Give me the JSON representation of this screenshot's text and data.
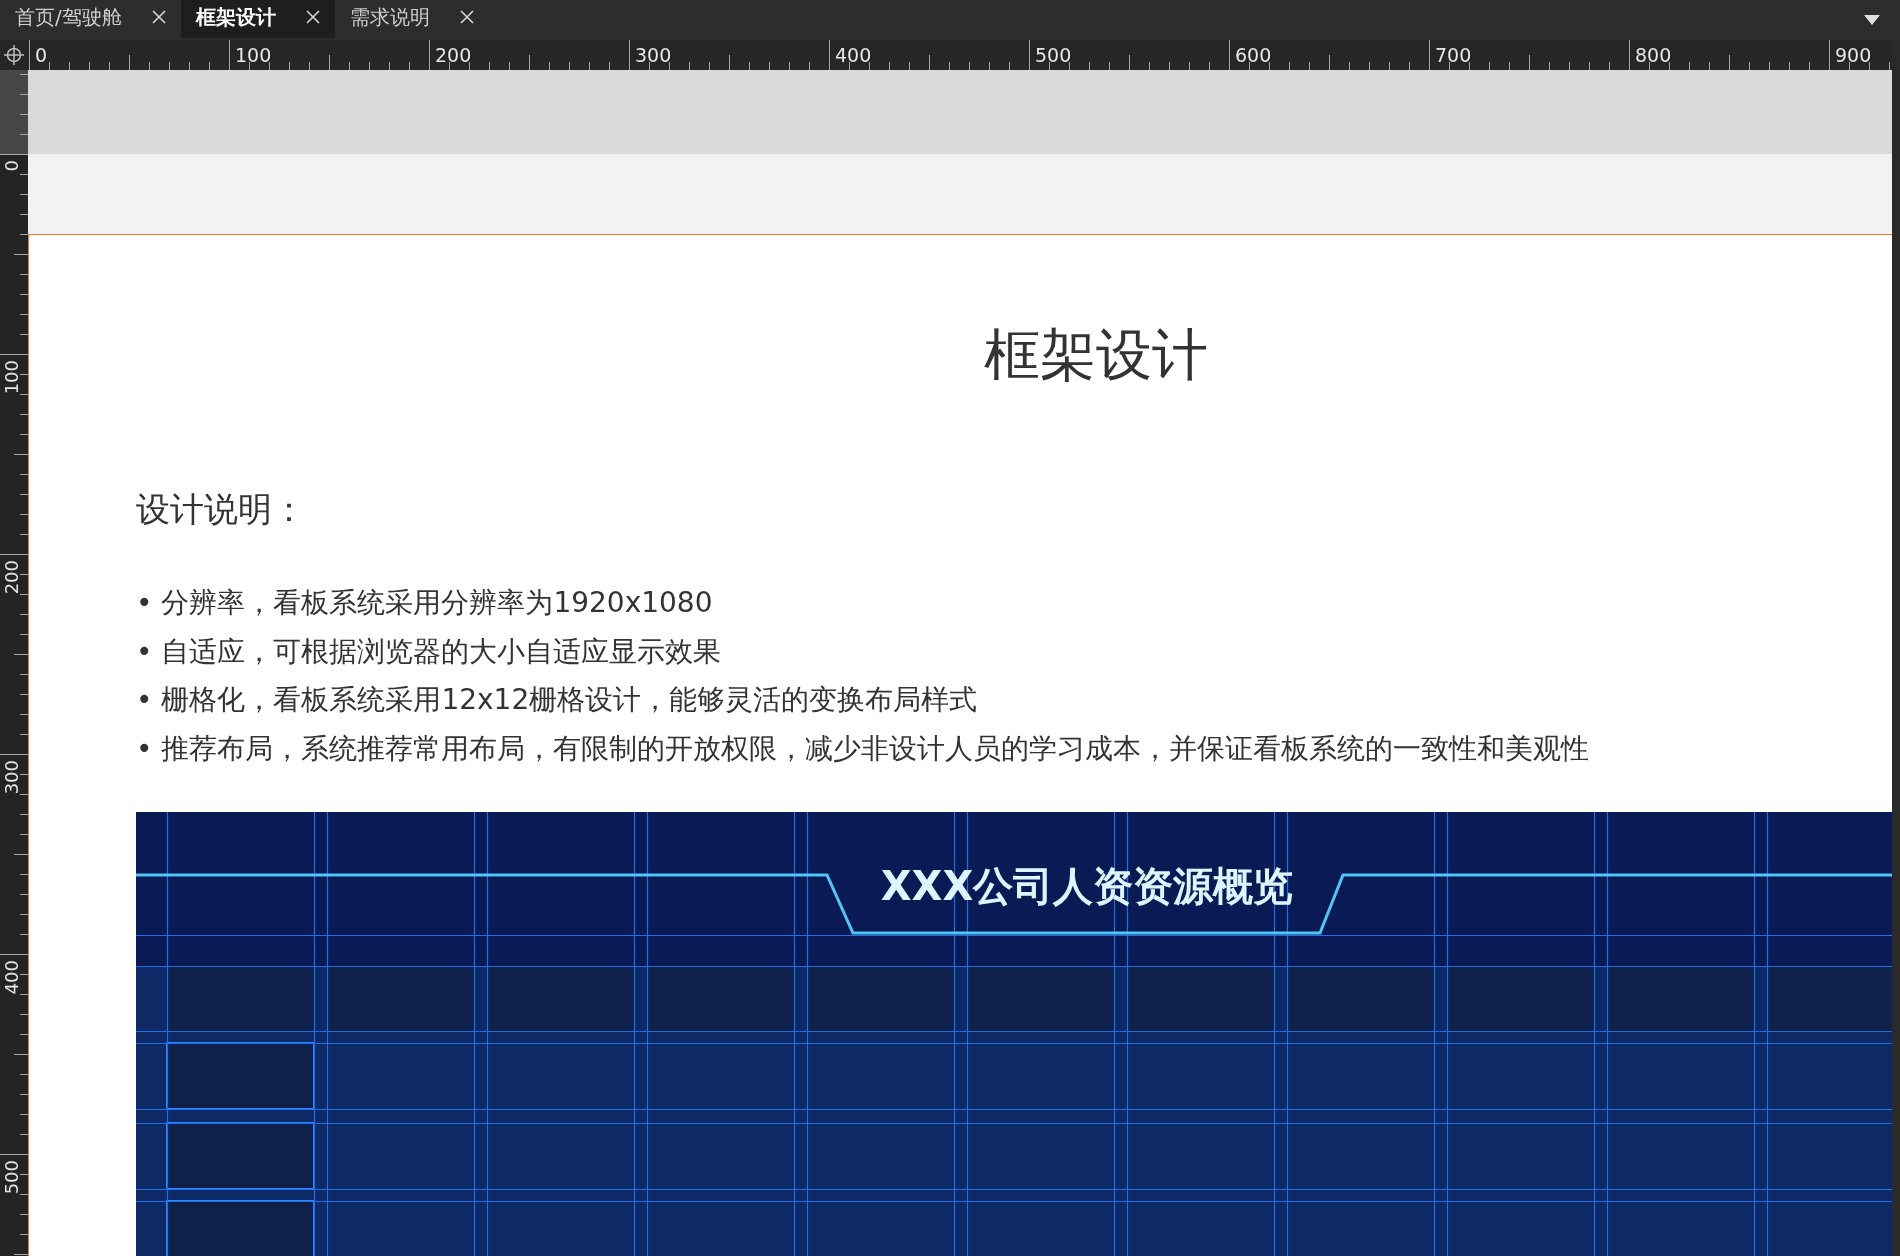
{
  "tabs": [
    {
      "label": "首页/驾驶舱",
      "selected": false
    },
    {
      "label": "框架设计",
      "selected": true
    },
    {
      "label": "需求说明",
      "selected": false
    }
  ],
  "rulers": {
    "horizontal": [
      "0",
      "100",
      "200",
      "300",
      "400",
      "500",
      "600",
      "700",
      "800",
      "900"
    ],
    "vertical": [
      "0",
      "100",
      "200",
      "300",
      "400",
      "500"
    ]
  },
  "page": {
    "title": "框架设计",
    "section_heading": "设计说明：",
    "notes": [
      "• 分辨率，看板系统采用分辨率为1920x1080",
      "• 自适应，可根据浏览器的大小自适应显示效果",
      "• 栅格化，看板系统采用12x12栅格设计，能够灵活的变换布局样式",
      "• 推荐布局，系统推荐常用布局，有限制的开放权限，减少非设计人员的学习成本，并保证看板系统的一致性和美观性"
    ]
  },
  "dashboard_preview": {
    "title": "XXX公司人资资源概览"
  }
}
